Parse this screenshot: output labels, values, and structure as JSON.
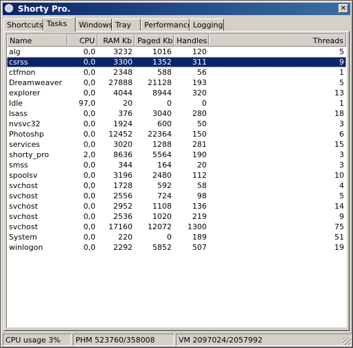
{
  "window": {
    "title": "Shorty Pro.",
    "close_glyph": "✕"
  },
  "tabs": [
    {
      "label": "Shortcuts",
      "active": false
    },
    {
      "label": "Tasks",
      "active": true
    },
    {
      "label": "Windows",
      "active": false
    },
    {
      "label": "Tray",
      "active": false
    },
    {
      "label": "Performance",
      "active": false
    },
    {
      "label": "Logging",
      "active": false
    }
  ],
  "columns": [
    "Name",
    "CPU",
    "RAM Kb",
    "Paged Kb",
    "Handles",
    "Threads"
  ],
  "rows": [
    {
      "name": "alg",
      "cpu": "0,0",
      "ram": "3232",
      "paged": "1016",
      "handles": "120",
      "threads": "5"
    },
    {
      "name": "csrss",
      "cpu": "0,0",
      "ram": "3300",
      "paged": "1352",
      "handles": "311",
      "threads": "9",
      "selected": true
    },
    {
      "name": "ctfmon",
      "cpu": "0,0",
      "ram": "2348",
      "paged": "588",
      "handles": "56",
      "threads": "1"
    },
    {
      "name": "Dreamweaver",
      "cpu": "0,0",
      "ram": "27888",
      "paged": "21128",
      "handles": "193",
      "threads": "5"
    },
    {
      "name": "explorer",
      "cpu": "0,0",
      "ram": "4044",
      "paged": "8944",
      "handles": "320",
      "threads": "13"
    },
    {
      "name": "Idle",
      "cpu": "97,0",
      "ram": "20",
      "paged": "0",
      "handles": "0",
      "threads": "1"
    },
    {
      "name": "lsass",
      "cpu": "0,0",
      "ram": "376",
      "paged": "3040",
      "handles": "280",
      "threads": "18"
    },
    {
      "name": "nvsvc32",
      "cpu": "0,0",
      "ram": "1924",
      "paged": "600",
      "handles": "50",
      "threads": "3"
    },
    {
      "name": "Photoshp",
      "cpu": "0,0",
      "ram": "12452",
      "paged": "22364",
      "handles": "150",
      "threads": "6"
    },
    {
      "name": "services",
      "cpu": "0,0",
      "ram": "3020",
      "paged": "1288",
      "handles": "281",
      "threads": "15"
    },
    {
      "name": "shorty_pro",
      "cpu": "2,0",
      "ram": "8636",
      "paged": "5564",
      "handles": "190",
      "threads": "3"
    },
    {
      "name": "smss",
      "cpu": "0,0",
      "ram": "344",
      "paged": "164",
      "handles": "20",
      "threads": "3"
    },
    {
      "name": "spoolsv",
      "cpu": "0,0",
      "ram": "3196",
      "paged": "2480",
      "handles": "112",
      "threads": "10"
    },
    {
      "name": "svchost",
      "cpu": "0,0",
      "ram": "1728",
      "paged": "592",
      "handles": "58",
      "threads": "4"
    },
    {
      "name": "svchost",
      "cpu": "0,0",
      "ram": "2556",
      "paged": "724",
      "handles": "98",
      "threads": "5"
    },
    {
      "name": "svchost",
      "cpu": "0,0",
      "ram": "2952",
      "paged": "1108",
      "handles": "136",
      "threads": "14"
    },
    {
      "name": "svchost",
      "cpu": "0,0",
      "ram": "2536",
      "paged": "1020",
      "handles": "219",
      "threads": "9"
    },
    {
      "name": "svchost",
      "cpu": "0,0",
      "ram": "17160",
      "paged": "12072",
      "handles": "1300",
      "threads": "75"
    },
    {
      "name": "System",
      "cpu": "0,0",
      "ram": "220",
      "paged": "0",
      "handles": "189",
      "threads": "51"
    },
    {
      "name": "winlogon",
      "cpu": "0,0",
      "ram": "2292",
      "paged": "5852",
      "handles": "507",
      "threads": "19"
    }
  ],
  "status": {
    "cpu": "CPU usage 3%",
    "phm": "PHM 523760/358008",
    "vm": "VM 2097024/2057992"
  }
}
